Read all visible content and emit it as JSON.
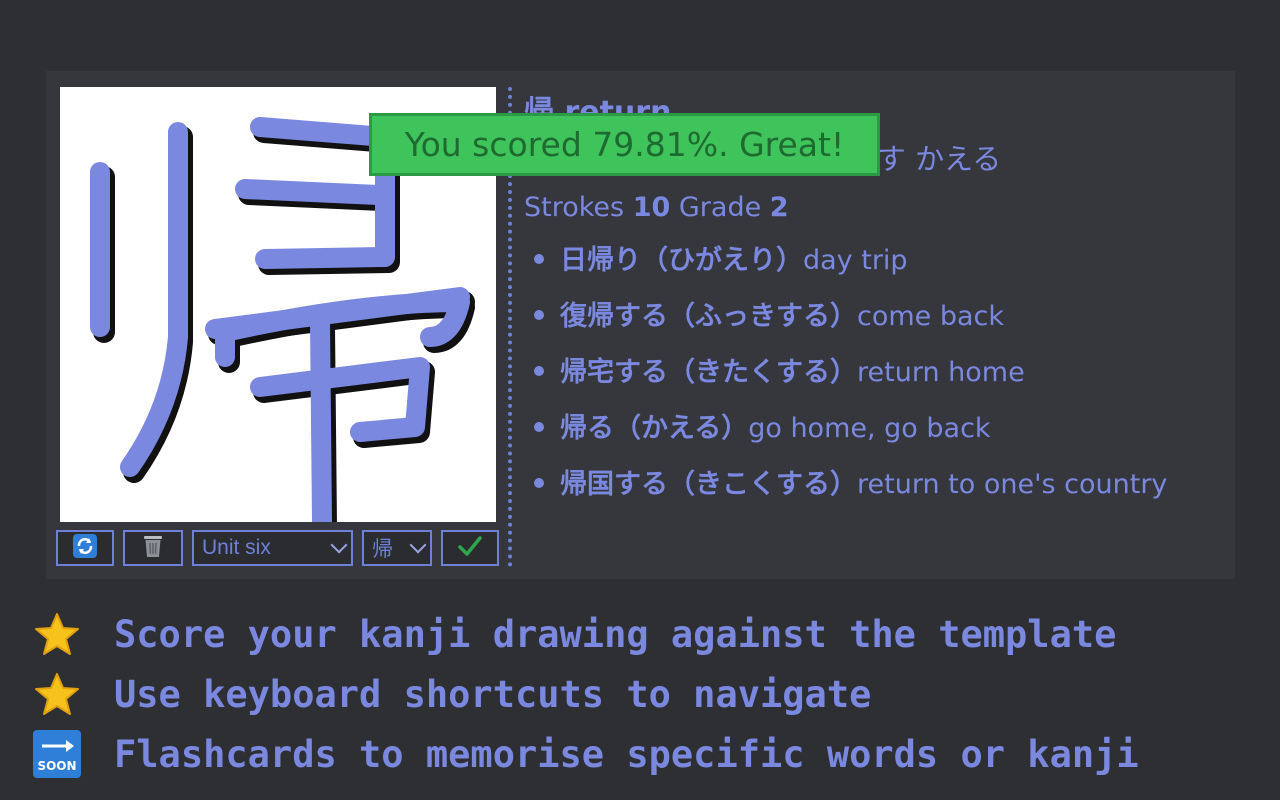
{
  "toolbar": {
    "unit_select_value": "Unit six",
    "kanji_select_value": "帰"
  },
  "kanji_info": {
    "header": "帰 return",
    "readings": "Readings キ かえ.る かえ.す かえる",
    "strokes_label": "Strokes",
    "strokes_value": "10",
    "grade_label": "Grade",
    "grade_value": "2",
    "vocab": [
      {
        "word": "日帰り（ひがえり）",
        "meaning": "day trip"
      },
      {
        "word": "復帰する（ふっきする）",
        "meaning": "come back"
      },
      {
        "word": "帰宅する（きたくする）",
        "meaning": "return home"
      },
      {
        "word": "帰る（かえる）",
        "meaning": "go home, go back"
      },
      {
        "word": "帰国する（きこくする）",
        "meaning": "return to one's country"
      }
    ]
  },
  "score_toast": "You scored 79.81%. Great!",
  "features": [
    {
      "icon": "star-icon",
      "text": "Score your kanji drawing against the template"
    },
    {
      "icon": "star-icon",
      "text": "Use keyboard shortcuts to navigate"
    },
    {
      "icon": "soon-icon",
      "text": "Flashcards to memorise specific words or kanji"
    }
  ],
  "colors": {
    "accent": "#7b88e0",
    "stroke": "#6f80d8",
    "panel": "#35373c",
    "background": "#2d2f33",
    "toast": "#3ec45b"
  }
}
